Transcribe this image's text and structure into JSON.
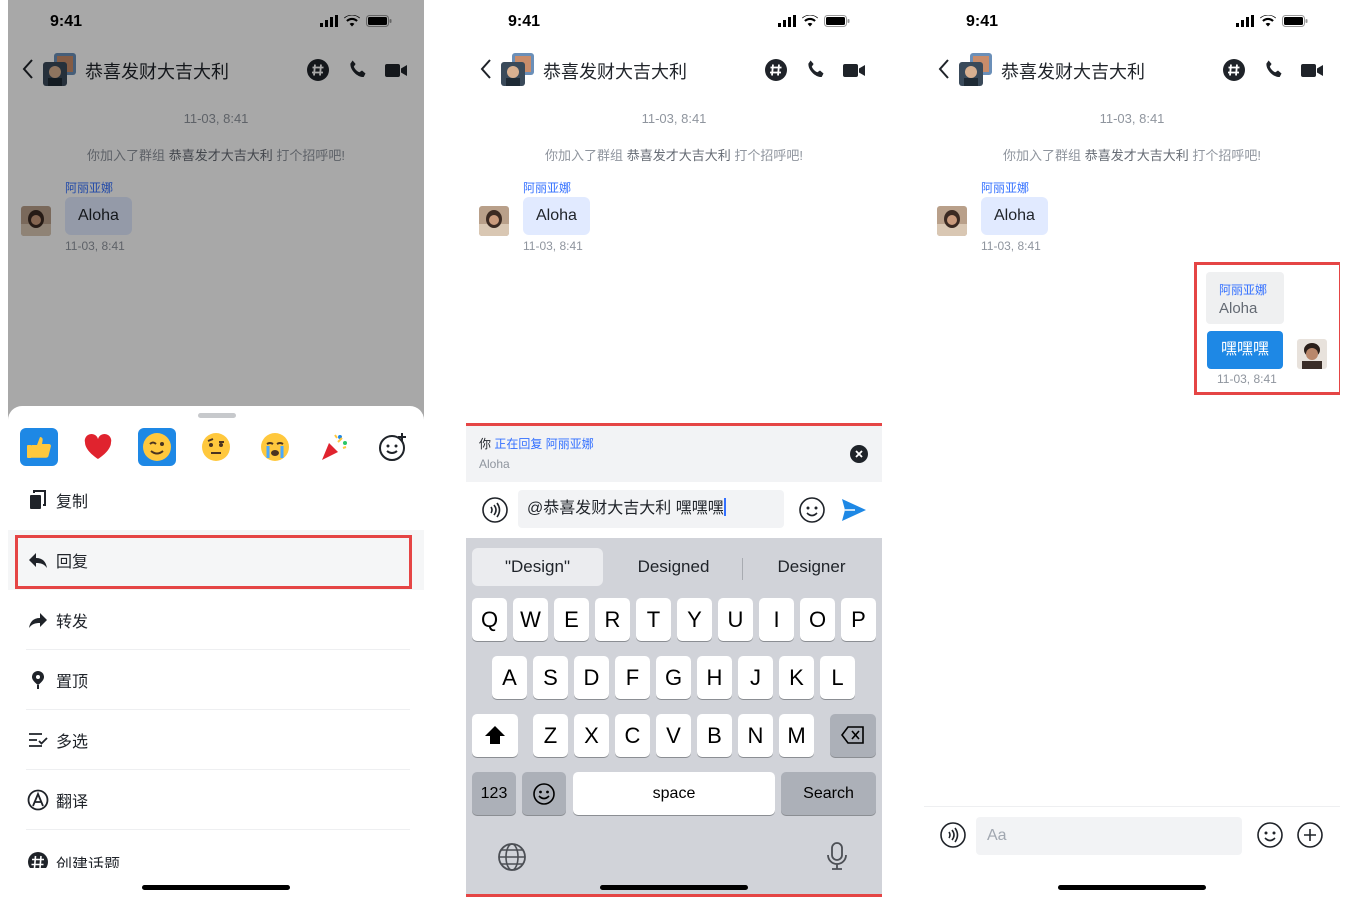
{
  "status": {
    "time": "9:41"
  },
  "chat": {
    "title": "恭喜发财大吉大利",
    "date_divider": "11-03, 8:41",
    "system_msg_prefix": "你加入了群组",
    "system_msg_group": "恭喜发才大吉大利",
    "system_msg_suffix": "打个招呼吧!",
    "sender_name": "阿丽亚娜",
    "message_text": "Aloha",
    "message_time": "11-03, 8:41"
  },
  "context_menu": {
    "reactions": [
      "thumbs-up",
      "heart",
      "wink",
      "raised-eyebrow",
      "crying",
      "party-popper",
      "add-reaction"
    ],
    "items": [
      {
        "label": "复制",
        "icon": "copy-icon"
      },
      {
        "label": "回复",
        "icon": "reply-icon"
      },
      {
        "label": "转发",
        "icon": "forward-icon"
      },
      {
        "label": "置顶",
        "icon": "pin-icon"
      },
      {
        "label": "多选",
        "icon": "multi-select-icon"
      },
      {
        "label": "翻译",
        "icon": "translate-icon"
      },
      {
        "label": "创建话题",
        "icon": "topic-icon"
      }
    ]
  },
  "reply_bar": {
    "you": "你",
    "replying_to": "正在回复 阿丽亚娜",
    "quoted_text": "Aloha"
  },
  "composer": {
    "value": "@恭喜发财大吉大利 嘿嘿嘿",
    "placeholder": "Aa"
  },
  "keyboard": {
    "suggestions": [
      "\"Design\"",
      "Designed",
      "Designer"
    ],
    "row1": [
      "Q",
      "W",
      "E",
      "R",
      "T",
      "Y",
      "U",
      "I",
      "O",
      "P"
    ],
    "row2": [
      "A",
      "S",
      "D",
      "F",
      "G",
      "H",
      "J",
      "K",
      "L"
    ],
    "row3": [
      "Z",
      "X",
      "C",
      "V",
      "B",
      "N",
      "M"
    ],
    "numbers_key": "123",
    "space_key": "space",
    "action_key": "Search"
  },
  "sent_reply": {
    "quoted_sender": "阿丽亚娜",
    "quoted_text": "Aloha",
    "text": "嘿嘿嘿",
    "time": "11-03, 8:41"
  },
  "colors": {
    "accent": "#3370ff",
    "sent_bubble": "#1e88e5",
    "highlight_border": "#e54545"
  }
}
